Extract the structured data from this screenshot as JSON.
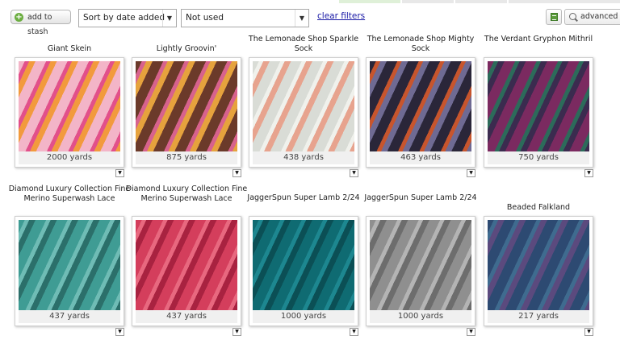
{
  "toolbar": {
    "add_label": "add to stash",
    "sort": {
      "selected": "Sort by date added"
    },
    "filter": {
      "selected": "Not used"
    },
    "clear_label": "clear filters",
    "advanced_label": "advanced search"
  },
  "icons": {
    "add": "plus-circle-icon",
    "dropdown": "chevron-down-icon",
    "spreadsheet": "spreadsheet-icon",
    "search": "search-icon",
    "card_menu": "triangle-down-icon"
  },
  "items": [
    {
      "title": "Giant Skein",
      "yards": "2000 yards",
      "colors": [
        "#f3b5c8",
        "#e2508a",
        "#f29a3d",
        "#fbe3b0"
      ]
    },
    {
      "title": "Lightly Groovin'",
      "yards": "875 yards",
      "colors": [
        "#6b3a2a",
        "#d7628d",
        "#e6a23d",
        "#7ab8a5"
      ]
    },
    {
      "title": "The Lemonade Shop Sparkle Sock",
      "yards": "438 yards",
      "colors": [
        "#d9dcd6",
        "#f0f1ec",
        "#e7a38e",
        "#9aa5a0"
      ]
    },
    {
      "title": "The Lemonade Shop Mighty Sock",
      "yards": "463 yards",
      "colors": [
        "#2a2639",
        "#c7552d",
        "#6f6a93",
        "#3e3a55"
      ]
    },
    {
      "title": "The Verdant Gryphon Mithril",
      "yards": "750 yards",
      "colors": [
        "#7b2a60",
        "#2c6b5a",
        "#3b2b4f",
        "#d8d0cf"
      ]
    },
    {
      "title": "Diamond Luxury Collection Fine Merino Superwash Lace",
      "yards": "437 yards",
      "colors": [
        "#3f9c94",
        "#6fbcb5",
        "#2b6f6a",
        "#c8c0b5"
      ]
    },
    {
      "title": "Diamond Luxury Collection Fine Merino Superwash Lace",
      "yards": "437 yards",
      "colors": [
        "#d43e5c",
        "#e8687f",
        "#a82240",
        "#bdb8b4"
      ]
    },
    {
      "title": "JaggerSpun Super Lamb 2/24",
      "yards": "1000 yards",
      "colors": [
        "#0f6b72",
        "#1d8790",
        "#0b4f55",
        "#c9c5be"
      ]
    },
    {
      "title": "JaggerSpun Super Lamb 2/24",
      "yards": "1000 yards",
      "colors": [
        "#8f8f8f",
        "#b4b4b4",
        "#6d6d6d",
        "#d6d3cf"
      ]
    },
    {
      "title": "Beaded Falkland",
      "yards": "217 yards",
      "colors": [
        "#2d4a72",
        "#3f6b8f",
        "#5b4a7e",
        "#9aa0b0"
      ]
    }
  ]
}
